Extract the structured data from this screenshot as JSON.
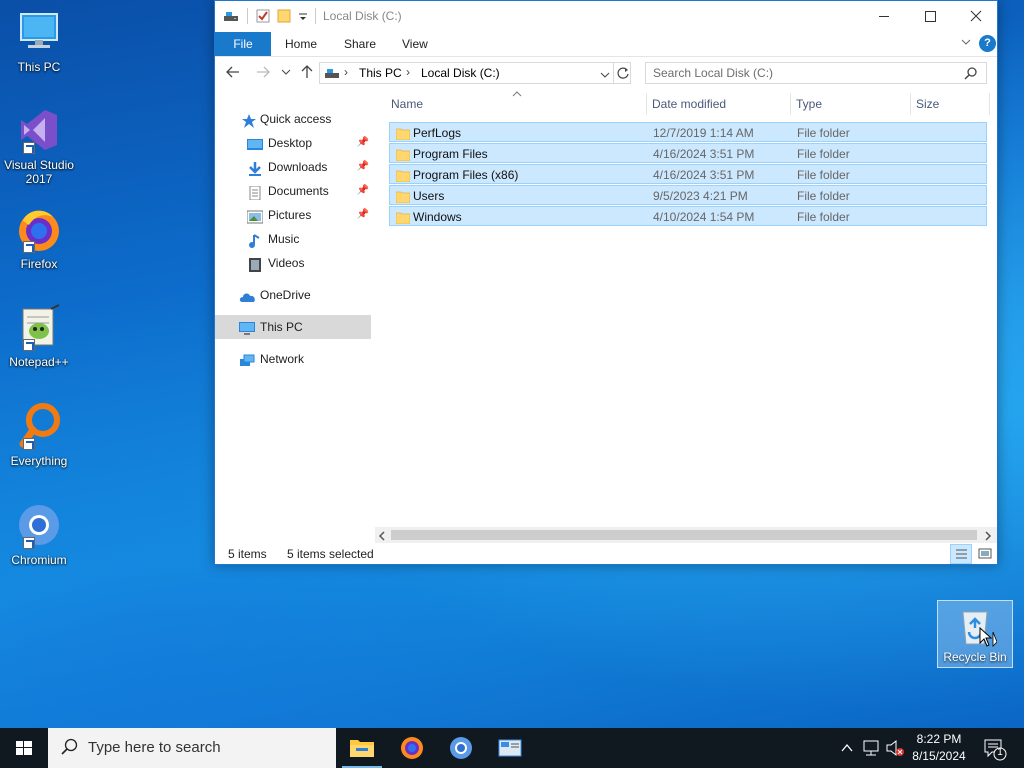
{
  "desktop": {
    "icons": [
      {
        "label": "This PC",
        "icon": "this-pc-icon"
      },
      {
        "label": "Visual Studio 2017",
        "icon": "visual-studio-icon"
      },
      {
        "label": "Firefox",
        "icon": "firefox-icon"
      },
      {
        "label": "Notepad++",
        "icon": "notepad-plus-plus-icon"
      },
      {
        "label": "Everything",
        "icon": "everything-icon"
      },
      {
        "label": "Chromium",
        "icon": "chromium-icon"
      }
    ],
    "recycle_bin": {
      "label": "Recycle Bin",
      "icon": "recycle-bin-icon"
    }
  },
  "window": {
    "title": "Local Disk (C:)",
    "ribbon_tabs": [
      "File",
      "Home",
      "Share",
      "View"
    ],
    "address": {
      "crumbs": [
        "This PC",
        "Local Disk (C:)"
      ]
    },
    "search": {
      "placeholder": "Search Local Disk (C:)"
    },
    "nav_pane": {
      "quick_access": "Quick access",
      "quick_items": [
        {
          "label": "Desktop",
          "pinned": true
        },
        {
          "label": "Downloads",
          "pinned": true
        },
        {
          "label": "Documents",
          "pinned": true
        },
        {
          "label": "Pictures",
          "pinned": true
        },
        {
          "label": "Music",
          "pinned": false
        },
        {
          "label": "Videos",
          "pinned": false
        }
      ],
      "onedrive": "OneDrive",
      "this_pc": "This PC",
      "network": "Network"
    },
    "columns": {
      "name": "Name",
      "date": "Date modified",
      "type": "Type",
      "size": "Size"
    },
    "files": [
      {
        "name": "PerfLogs",
        "date": "12/7/2019 1:14 AM",
        "type": "File folder",
        "size": ""
      },
      {
        "name": "Program Files",
        "date": "4/16/2024 3:51 PM",
        "type": "File folder",
        "size": ""
      },
      {
        "name": "Program Files (x86)",
        "date": "4/16/2024 3:51 PM",
        "type": "File folder",
        "size": ""
      },
      {
        "name": "Users",
        "date": "9/5/2023 4:21 PM",
        "type": "File folder",
        "size": ""
      },
      {
        "name": "Windows",
        "date": "4/10/2024 1:54 PM",
        "type": "File folder",
        "size": ""
      }
    ],
    "status": {
      "items": "5 items",
      "selected": "5 items selected"
    }
  },
  "taskbar": {
    "search_placeholder": "Type here to search",
    "clock_time": "8:22 PM",
    "clock_date": "8/15/2024",
    "notification_count": "1"
  },
  "colors": {
    "accent": "#1979ca",
    "selection_bg": "#cce8ff",
    "selection_border": "#99d1ff",
    "taskbar": "#101820",
    "folder": "#ffd76e"
  }
}
